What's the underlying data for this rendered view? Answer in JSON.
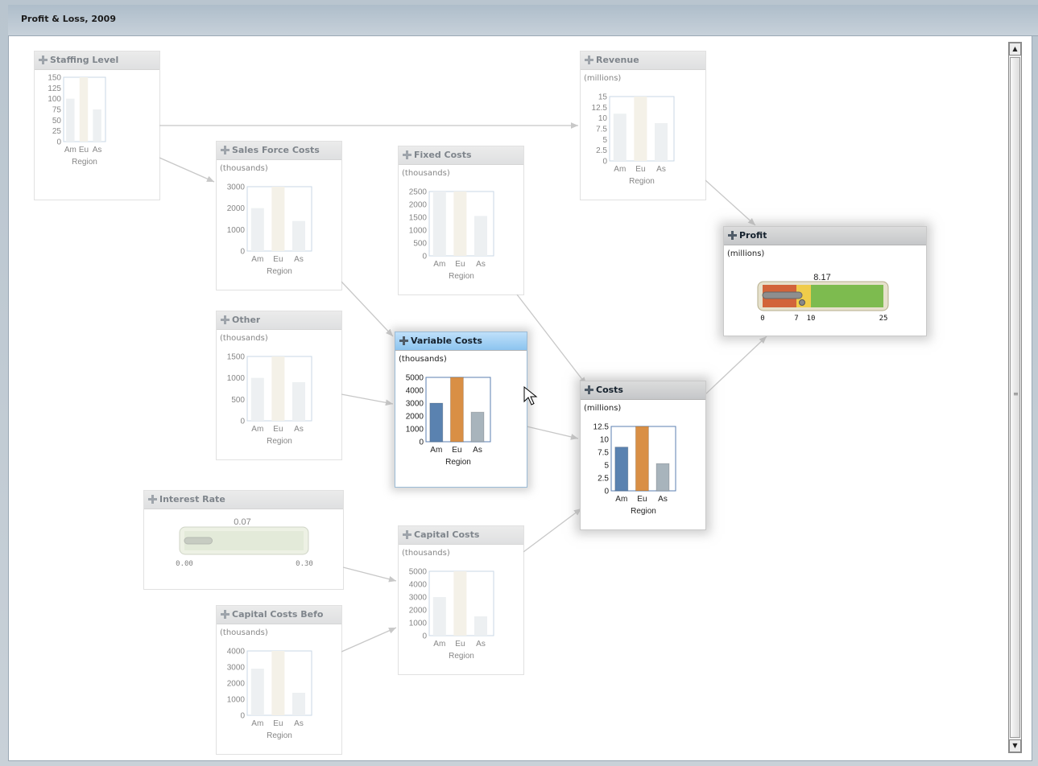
{
  "window": {
    "title": "Profit & Loss, 2009"
  },
  "regions": [
    "Am",
    "Eu",
    "As"
  ],
  "region_axis_label": "Region",
  "colors": {
    "am": "#5a82b0",
    "eu": "#d98f45",
    "as": "#a8b4bc",
    "gauge_red": "#d2643a",
    "gauge_yellow": "#f0cc4a",
    "gauge_green": "#7dbb4f"
  },
  "nodes": {
    "staffing_level": {
      "title": "Staffing Level",
      "unit": "",
      "ticks": [
        "150",
        "125",
        "100",
        "75",
        "50",
        "25",
        "0"
      ],
      "values": [
        100,
        150,
        75
      ],
      "ymax": 150
    },
    "sales_force_costs": {
      "title": "Sales Force Costs",
      "unit": "(thousands)",
      "ticks": [
        "3000",
        "2000",
        "1000",
        "0"
      ],
      "values": [
        2000,
        3300,
        1400
      ],
      "ymax": 3000
    },
    "fixed_costs": {
      "title": "Fixed Costs",
      "unit": "(thousands)",
      "ticks": [
        "2500",
        "2000",
        "1500",
        "1000",
        "500",
        "0"
      ],
      "values": [
        2500,
        2700,
        1550
      ],
      "ymax": 2500
    },
    "revenue": {
      "title": "Revenue",
      "unit": "(millions)",
      "ticks": [
        "15",
        "12.5",
        "10",
        "7.5",
        "5",
        "2.5",
        "0"
      ],
      "values": [
        11,
        15,
        8.8
      ],
      "ymax": 15
    },
    "other": {
      "title": "Other",
      "unit": "(thousands)",
      "ticks": [
        "1500",
        "1000",
        "500",
        "0"
      ],
      "values": [
        1000,
        1550,
        900
      ],
      "ymax": 1500
    },
    "variable_costs": {
      "title": "Variable Costs",
      "unit": "(thousands)",
      "ticks": [
        "5000",
        "4000",
        "3000",
        "2000",
        "1000",
        "0"
      ],
      "values": [
        3000,
        5000,
        2300
      ],
      "ymax": 5000
    },
    "costs": {
      "title": "Costs",
      "unit": "(millions)",
      "ticks": [
        "12.5",
        "10",
        "7.5",
        "5",
        "2.5",
        "0"
      ],
      "values": [
        8.5,
        12.5,
        5.3
      ],
      "ymax": 12.5
    },
    "profit": {
      "title": "Profit",
      "unit": "(millions)",
      "gauge_value": "8.17",
      "value": 8.17,
      "min": 0,
      "max": 25,
      "thresholds": [
        7,
        10
      ],
      "tick_labels": [
        "0",
        "7",
        "10",
        "25"
      ]
    },
    "interest_rate": {
      "title": "Interest Rate",
      "gauge_value": "0.07",
      "value": 0.07,
      "min": 0,
      "max": 0.3,
      "tick_labels": [
        "0.00",
        "0.30"
      ]
    },
    "capital_costs": {
      "title": "Capital Costs",
      "unit": "(thousands)",
      "ticks": [
        "5000",
        "4000",
        "3000",
        "2000",
        "1000",
        "0"
      ],
      "values": [
        3000,
        5000,
        1500
      ],
      "ymax": 5000
    },
    "capital_costs_before": {
      "title": "Capital Costs Befo",
      "unit": "(thousands)",
      "ticks": [
        "4000",
        "3000",
        "2000",
        "1000",
        "0"
      ],
      "values": [
        2900,
        4500,
        1400
      ],
      "ymax": 4000
    }
  },
  "scrollbar": {
    "up": "▲",
    "down": "▼",
    "grip": "≡"
  }
}
